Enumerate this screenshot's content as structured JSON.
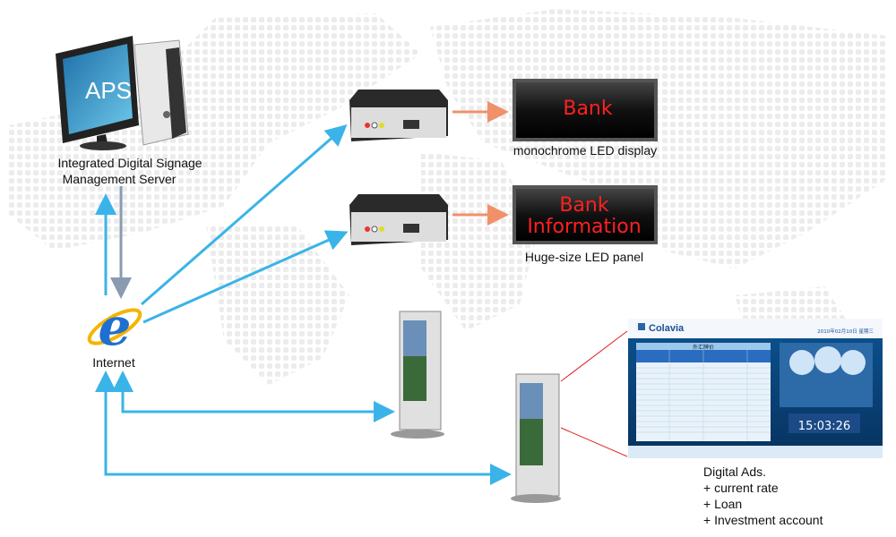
{
  "server": {
    "screen_text": "APS",
    "label_line1": "Integrated Digital Signage",
    "label_line2": "Management Server"
  },
  "internet": {
    "label": "Internet",
    "icon": "internet-explorer-icon"
  },
  "led_display": {
    "text": "Bank",
    "label": "monochrome LED display"
  },
  "led_panel": {
    "text_line1": "Bank",
    "text_line2": "Information",
    "label": "Huge-size LED panel"
  },
  "ads_screen": {
    "brand": "Colavia",
    "date": "2010年02月10日  星期三",
    "table_title": "外汇牌价",
    "clock": "15:03:26"
  },
  "ads_label": {
    "title": "Digital Ads.",
    "items": [
      "+ current rate",
      "+ Loan",
      "+ Investment account"
    ]
  },
  "colors": {
    "network_arrow": "#3ab4e8",
    "output_arrow": "#f0916a",
    "led_text": "#ff2020",
    "callout_line": "#e02020"
  }
}
